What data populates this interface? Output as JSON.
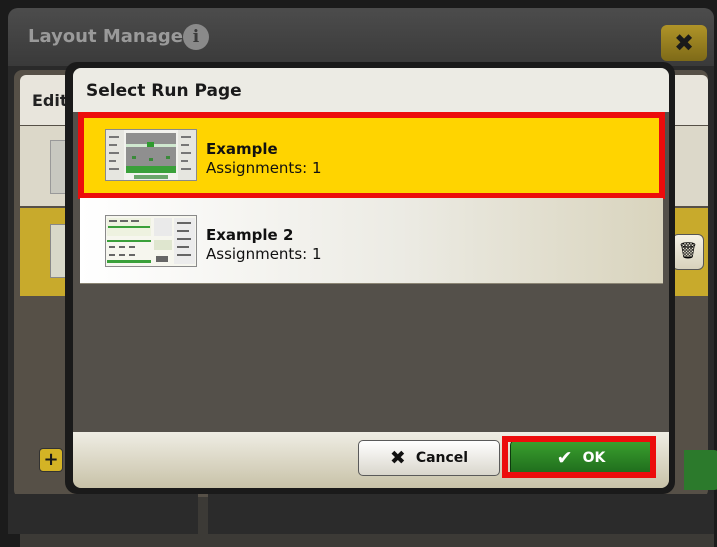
{
  "background": {
    "title": "Layout Manager",
    "info_icon": "info-icon",
    "close_icon": "close-icon",
    "tab_label": "Edit",
    "trash_icon": "trash-icon",
    "add_icon": "plus-icon"
  },
  "dialog": {
    "title": "Select Run Page",
    "pages": [
      {
        "name": "Example",
        "assignments": "Assignments: 1",
        "selected": true
      },
      {
        "name": "Example 2",
        "assignments": "Assignments: 1",
        "selected": false
      }
    ],
    "cancel_label": "Cancel",
    "ok_label": "OK",
    "cancel_icon": "close-x-icon",
    "ok_icon": "checkmark-icon"
  },
  "colors": {
    "selected_row": "#ffd400",
    "highlight_outline": "#ec0c0c",
    "ok_button": "#2e8a26",
    "background_selected_row": "#c8aa2c"
  }
}
